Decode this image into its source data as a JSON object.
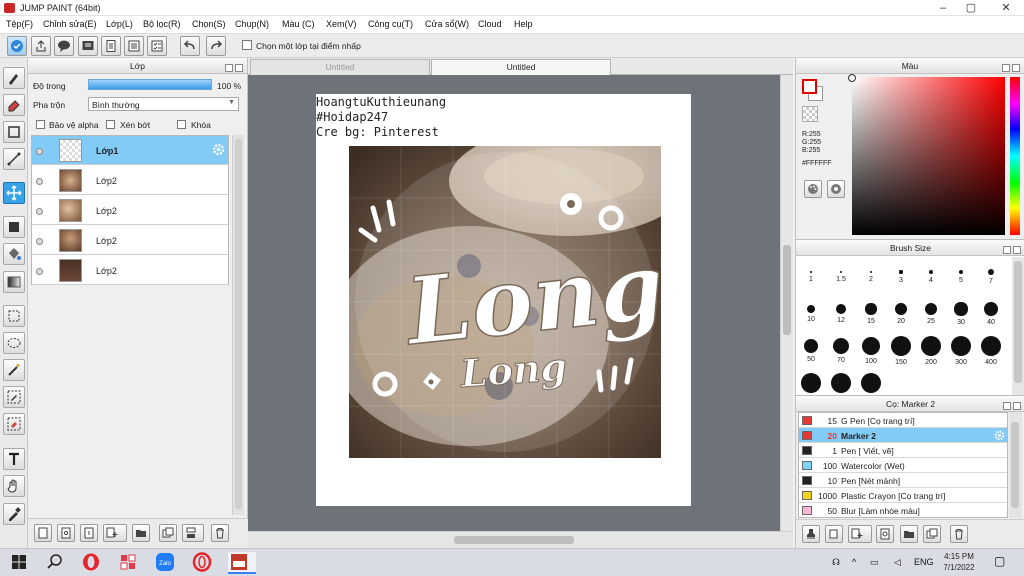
{
  "window": {
    "title": "JUMP PAINT (64bit)",
    "minimize": "–",
    "maximize": "▢",
    "close": "✕"
  },
  "menu": [
    "Tệp(F)",
    "Chỉnh sửa(E)",
    "Lớp(L)",
    "Bộ lọc(R)",
    "Chọn(S)",
    "Chụp(N)",
    "Màu (C)",
    "Xem(V)",
    "Công cụ(T)",
    "Cửa sổ(W)",
    "Cloud",
    "Help"
  ],
  "toolbar": {
    "select_layer_label": "Chọn một lớp tại điểm nhấp"
  },
  "layer_panel": {
    "title": "Lớp",
    "opacity_label": "Độ trong",
    "opacity_value": "100 %",
    "opacity_percent": 100,
    "blend_label": "Pha trộn",
    "blend_value": "Bình thường",
    "protect_alpha": "Bảo vệ alpha",
    "clipping": "Xén bớt",
    "lock": "Khóa",
    "layers": [
      {
        "name": "Lớp1",
        "selected": true
      },
      {
        "name": "Lớp2",
        "selected": false
      },
      {
        "name": "Lớp2",
        "selected": false
      },
      {
        "name": "Lớp2",
        "selected": false
      },
      {
        "name": "Lớp2",
        "selected": false
      }
    ]
  },
  "tabs": [
    {
      "label": "Untitled",
      "active": false
    },
    {
      "label": "Untitled",
      "active": true
    }
  ],
  "canvas": {
    "text_lines": [
      "HoangtuKuthieunang",
      "#Hoidap247",
      "Cre bg: Pinterest"
    ],
    "art_main": "Long",
    "art_sub": "Long"
  },
  "color_panel": {
    "title": "Màu",
    "r": "R:255",
    "g": "G:255",
    "b": "B:255",
    "hex": "#FFFFFF",
    "fg_color": "#ffffff",
    "hue_color": "#ff0000"
  },
  "brush_panel": {
    "title": "Brush Size",
    "sizes": [
      "1",
      "1.5",
      "2",
      "3",
      "4",
      "5",
      "7",
      "10",
      "12",
      "15",
      "20",
      "25",
      "30",
      "40",
      "50",
      "70",
      "100",
      "150",
      "200",
      "300",
      "400",
      "",
      "",
      ""
    ]
  },
  "marker_panel": {
    "title": "Cọ: Marker 2",
    "items": [
      {
        "size": "15",
        "name": "G Pen [Cọ trang trí]",
        "color": "#e53935",
        "selected": false
      },
      {
        "size": "20",
        "name": "Marker 2",
        "color": "#e53935",
        "selected": true
      },
      {
        "size": "1",
        "name": "Pen [ Viết, vẽ]",
        "color": "#222222",
        "selected": false
      },
      {
        "size": "100",
        "name": "Watercolor (Wet)",
        "color": "#7fd3f5",
        "selected": false
      },
      {
        "size": "10",
        "name": "Pen [Nét mảnh]",
        "color": "#222222",
        "selected": false
      },
      {
        "size": "1000",
        "name": "Plastic Crayon [Cọ trang trí]",
        "color": "#f2d21e",
        "selected": false
      },
      {
        "size": "50",
        "name": "Blur [Làm nhòe màu]",
        "color": "#f7b6d6",
        "selected": false
      }
    ]
  },
  "taskbar": {
    "lang": "ENG",
    "time": "4:15 PM",
    "date": "7/1/2022",
    "zalo_label": "Zalo"
  }
}
